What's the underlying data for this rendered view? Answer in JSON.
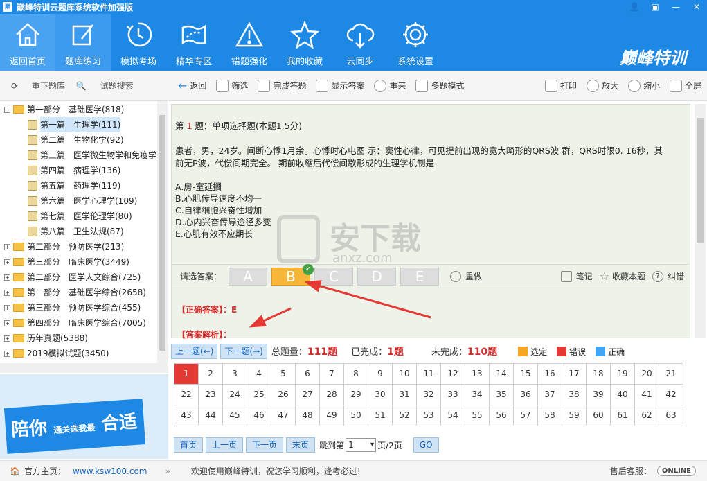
{
  "window": {
    "title": "巅峰特训云题库系统软件加强版",
    "app_icon_text": "巅峰"
  },
  "toolbar": {
    "items": [
      {
        "label": "返回首页",
        "icon": "home-icon"
      },
      {
        "label": "题库练习",
        "icon": "edit-icon"
      },
      {
        "label": "模拟考场",
        "icon": "clock-icon"
      },
      {
        "label": "精华专区",
        "icon": "map-icon"
      },
      {
        "label": "错题强化",
        "icon": "warning-icon"
      },
      {
        "label": "我的收藏",
        "icon": "star-icon"
      },
      {
        "label": "云同步",
        "icon": "cloud-icon"
      },
      {
        "label": "系统设置",
        "icon": "gear-icon"
      }
    ],
    "brand": "巅峰特训"
  },
  "left_toolbar": {
    "reload": "重下题库",
    "search": "试题搜索"
  },
  "tree": [
    {
      "label": "第一部分　基础医学(818)",
      "level": 0,
      "expanded": true
    },
    {
      "label": "第一篇　生理学(111)",
      "level": 1,
      "selected": true
    },
    {
      "label": "第二篇　生物化学(92)",
      "level": 1
    },
    {
      "label": "第三篇　医学微生物学和免疫学",
      "level": 1
    },
    {
      "label": "第四篇　病理学(136)",
      "level": 1
    },
    {
      "label": "第五篇　药理学(119)",
      "level": 1
    },
    {
      "label": "第六篇　医学心理学(109)",
      "level": 1
    },
    {
      "label": "第七篇　医学伦理学(80)",
      "level": 1
    },
    {
      "label": "第八篇　卫生法规(87)",
      "level": 1
    },
    {
      "label": "第二部分　预防医学(213)",
      "level": 0
    },
    {
      "label": "第三部分　临床医学(3449)",
      "level": 0
    },
    {
      "label": "第二部分　医学人文综合(725)",
      "level": 0
    },
    {
      "label": "第一部分　基础医学综合(2658)",
      "level": 0
    },
    {
      "label": "第三部分　预防医学综合(455)",
      "level": 0
    },
    {
      "label": "第四部分　临床医学综合(7005)",
      "level": 0
    },
    {
      "label": "历年真题(5388)",
      "level": 0
    },
    {
      "label": "2019模拟试题(3450)",
      "level": 0
    }
  ],
  "ad": {
    "line1": "陪你",
    "line2": "通关",
    "line3": "选我最",
    "line4": "合适"
  },
  "right_toolbar": [
    {
      "label": "返回"
    },
    {
      "label": "筛选"
    },
    {
      "label": "完成答题"
    },
    {
      "label": "显示答案"
    },
    {
      "label": "重来"
    },
    {
      "label": "多题模式"
    }
  ],
  "right_toolbar_right": [
    {
      "label": "打印"
    },
    {
      "label": "放大"
    },
    {
      "label": "缩小"
    },
    {
      "label": "全屏"
    }
  ],
  "question": {
    "header_prefix": "第 ",
    "number": "1",
    "header_suffix": " 题：单项选择题(本题1.5分)",
    "stem_line1": "患者，男，24岁。间断心悸1月余。心悸时心电图 示：窦性心律，可见提前出现的宽大畸形的QRS波 群，QRS时限0. 16秒，其",
    "stem_line2": "前无P波，代偿间期完全。 期前收缩后代偿间歇形成的生理学机制是",
    "options": [
      "A.房-室延搁",
      "B.心肌传导速度不均一",
      "C.自律细胞兴奋性增加",
      "D.心内兴奋传导途径多变",
      "E.心肌有效不应期长"
    ]
  },
  "answer_bar": {
    "label": "请选答案：",
    "choices": [
      "A",
      "B",
      "C",
      "D",
      "E"
    ],
    "selected": "B",
    "redo": "重做",
    "notes": "笔记",
    "favorite": "收藏本题",
    "report": "纠错"
  },
  "answer": {
    "correct": "【正确答案】：E",
    "analysis": "【答案解析】："
  },
  "nav": {
    "prev": "上一题(←)",
    "next": "下一题(→)",
    "total_label": "总题量：",
    "total": "111题",
    "done_label": "已完成：",
    "done": "1题",
    "undone_label": "未完成：",
    "undone": "110题",
    "legend": [
      {
        "label": "选定",
        "color": "#f5a623"
      },
      {
        "label": "错误",
        "color": "#e53935"
      },
      {
        "label": "正确",
        "color": "#42a5f5"
      }
    ]
  },
  "grid": {
    "current": 1,
    "numbers": [
      1,
      2,
      3,
      4,
      5,
      6,
      7,
      8,
      9,
      10,
      11,
      12,
      13,
      14,
      15,
      16,
      17,
      18,
      19,
      20,
      21,
      22,
      23,
      24,
      25,
      26,
      27,
      28,
      29,
      30,
      31,
      32,
      33,
      34,
      35,
      36,
      37,
      38,
      39,
      40,
      41,
      42,
      43,
      44,
      45,
      46,
      47,
      48,
      49,
      50,
      51,
      52,
      53,
      54,
      55,
      56,
      57,
      58,
      59,
      60,
      61,
      62,
      63
    ]
  },
  "pager": {
    "first": "首页",
    "prev": "上一页",
    "next": "下一页",
    "last": "末页",
    "jump_label": "跳到第",
    "page_value": "1",
    "page_suffix": "页/2页",
    "go": "GO"
  },
  "statusbar": {
    "home_label": "官方主页：",
    "home_url": "www.ksw100.com",
    "welcome": "欢迎使用巅峰特训，祝您学习顺利，逢考必过!",
    "service_label": "售后客服：",
    "online": "ONLINE"
  },
  "watermark": {
    "text": "安下载",
    "sub": "anxz.com"
  },
  "colors": {
    "primary": "#1e88e5",
    "selected": "#f5b63a",
    "error": "#e53935"
  }
}
